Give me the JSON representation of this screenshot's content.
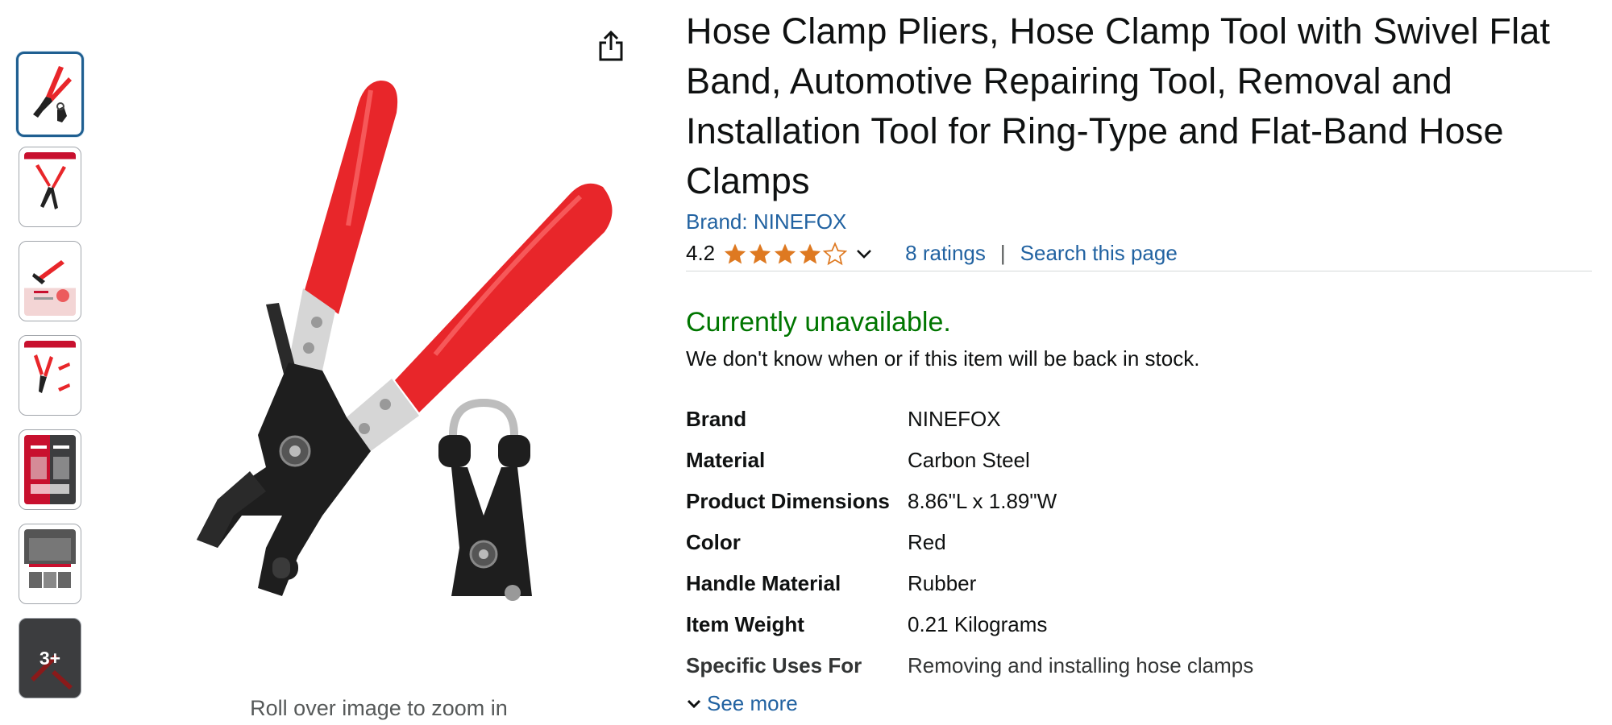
{
  "product": {
    "title": "Hose Clamp Pliers, Hose Clamp Tool with Swivel Flat Band, Automotive Repairing Tool, Removal and Installation Tool for Ring-Type and Flat-Band Hose Clamps",
    "brand_link": "Brand: NINEFOX",
    "rating_value": "4.2",
    "rating_stars": 4.2,
    "ratings_link": "8 ratings",
    "separator": "|",
    "search_link": "Search this page",
    "availability": "Currently unavailable.",
    "availability_note": "We don't know when or if this item will be back in stock.",
    "see_more": "See more"
  },
  "gallery": {
    "zoom_hint": "Roll over image to zoom in",
    "more_count": "3+",
    "thumbnails": [
      "pliers",
      "product-size",
      "features",
      "product-details",
      "comparison",
      "applications",
      "more"
    ]
  },
  "specs": [
    {
      "key": "Brand",
      "value": "NINEFOX"
    },
    {
      "key": "Material",
      "value": "Carbon Steel"
    },
    {
      "key": "Product Dimensions",
      "value": "8.86\"L x 1.89\"W"
    },
    {
      "key": "Color",
      "value": "Red"
    },
    {
      "key": "Handle Material",
      "value": "Rubber"
    },
    {
      "key": "Item Weight",
      "value": "0.21 Kilograms"
    },
    {
      "key": "Specific Uses For",
      "value": "Removing and installing hose clamps"
    }
  ],
  "colors": {
    "link": "#2162a1",
    "available_green": "#007600",
    "star_orange": "#de7921",
    "handle_red": "#e8262a",
    "selected_border": "#1f5f91"
  }
}
